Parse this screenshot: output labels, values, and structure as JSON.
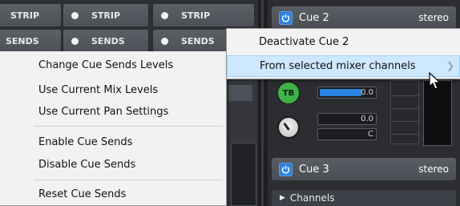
{
  "mixer": {
    "row1": [
      {
        "label": "STRIP"
      },
      {
        "label": "STRIP"
      },
      {
        "label": "STRIP"
      }
    ],
    "row2": [
      {
        "label": "SENDS"
      },
      {
        "label": "SENDS"
      },
      {
        "label": "SENDS"
      }
    ]
  },
  "cue2": {
    "name": "Cue 2",
    "mode": "stereo",
    "talkback_label": "TB",
    "level_value": "0.0",
    "pan_value": "0.0",
    "pan_position": "C"
  },
  "cue3": {
    "name": "Cue 3",
    "mode": "stereo"
  },
  "channels_label": "Channels",
  "left_menu": {
    "items": [
      "Change Cue Sends Levels",
      "Use Current Mix Levels",
      "Use Current Pan Settings",
      "Enable Cue Sends",
      "Disable Cue Sends",
      "Reset Cue Sends"
    ]
  },
  "right_menu": {
    "items": [
      "Deactivate Cue 2",
      "From selected mixer channels"
    ],
    "highlighted_index": 1
  },
  "colors": {
    "accent_blue": "#2f7fdc",
    "talkback_green": "#3fb24a",
    "menu_highlight": "#cde8ff"
  }
}
